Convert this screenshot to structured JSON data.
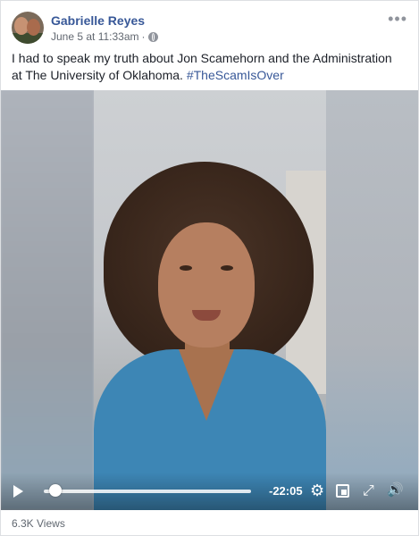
{
  "post": {
    "author": "Gabrielle Reyes",
    "timestamp": "June 5 at 11:33am",
    "separator": "·",
    "text": "I had to speak my truth about Jon Scamehorn and the Administration at The University of Oklahoma.",
    "hashtag": "#TheScamIsOver",
    "views": "6.3K Views"
  },
  "video": {
    "time_remaining": "-22:05",
    "progress_fraction": 0.03
  },
  "icons": {
    "more": "•••",
    "settings": "⚙",
    "volume": "🔊",
    "fullscreen": "⤢"
  },
  "colors": {
    "link": "#385898",
    "text": "#1d2129",
    "muted": "#616770"
  }
}
